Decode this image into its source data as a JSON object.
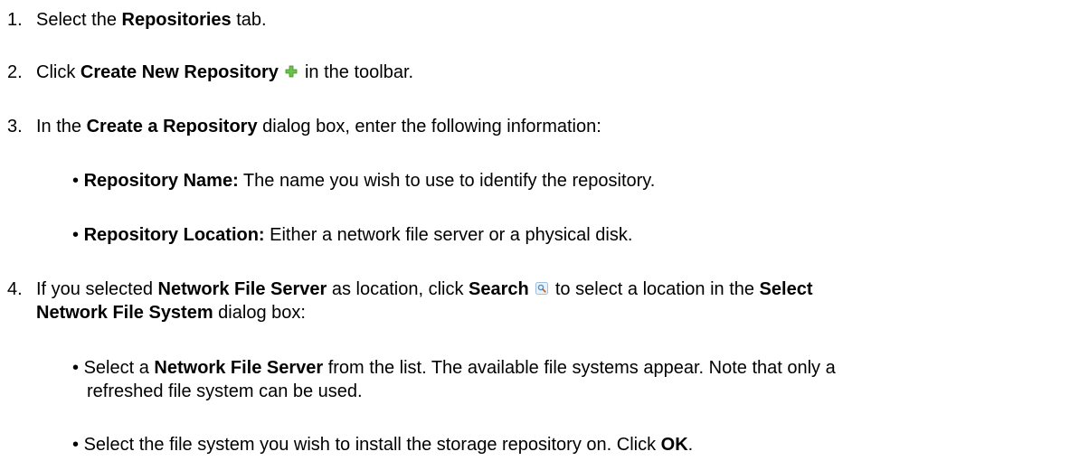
{
  "steps": [
    {
      "num": "1.",
      "t1": "Select the ",
      "b1": "Repositories",
      "t2": " tab."
    },
    {
      "num": "2.",
      "t1": "Click ",
      "b1": "Create New Repository",
      "icon": "plus-icon",
      "t2": " in the toolbar."
    },
    {
      "num": "3.",
      "t1": "In the ",
      "b1": "Create a Repository",
      "t2": " dialog box, enter the following information:",
      "bullets": [
        {
          "dot": "•",
          "b1": "Repository Name:",
          "t1": " The name you wish to use to identify the repository."
        },
        {
          "dot": "•",
          "b1": "Repository Location:",
          "t1": " Either a network file server or a physical disk."
        }
      ]
    },
    {
      "num": "4.",
      "t1": "If you selected ",
      "b1": "Network File Server",
      "t2": " as location, click ",
      "b2": "Search",
      "icon": "search-icon",
      "t3": " to select a location in the ",
      "b3": "Select",
      "b4": "Network File System",
      "t4": " dialog box:",
      "bullets": [
        {
          "dot": "•",
          "t1": "Select a ",
          "b1": "Network File Server",
          "t2": " from the list. The available file systems appear. Note that only a",
          "t3": "refreshed file system can be used."
        },
        {
          "dot": "•",
          "t1": "Select the file system you wish to install the storage repository on. Click ",
          "b1": "OK",
          "t2": "."
        }
      ]
    }
  ],
  "colors": {
    "plus_icon": "#6cc24a",
    "search_icon": "#5a8fc4"
  }
}
